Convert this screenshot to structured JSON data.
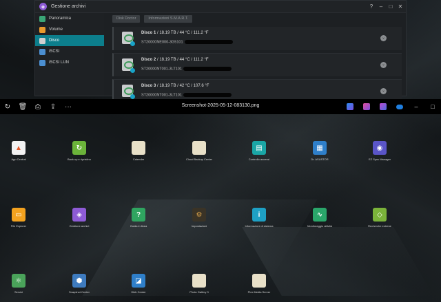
{
  "dsm_window": {
    "title": "Gestione archivi",
    "controls": [
      "?",
      "–",
      "□",
      "✕"
    ],
    "sidebar": [
      {
        "label": "Panoramica",
        "icon": "overview-icon",
        "color": "#3aa676"
      },
      {
        "label": "Volume",
        "icon": "volume-icon",
        "color": "#e89a2c"
      },
      {
        "label": "Disco",
        "icon": "disk-icon",
        "color": "#d0d0d0",
        "active": true
      },
      {
        "label": "iSCSI",
        "icon": "iscsi-icon",
        "color": "#4b8fd1"
      },
      {
        "label": "iSCSI LUN",
        "icon": "iscsi-lun-icon",
        "color": "#4b8fd1"
      }
    ],
    "tabs": [
      "Disk Doctor",
      "Informazioni S.M.A.R.T."
    ],
    "disks": [
      {
        "name": "Disco 1",
        "specs": " / 18.19 TB / 44 °C / 111.2 °F",
        "serial": "ST20000NE000-3G5101 "
      },
      {
        "name": "Disco 2",
        "specs": " / 18.19 TB / 44 °C / 111.2 °F",
        "serial": "ST20000NT001-3LT101 "
      },
      {
        "name": "Disco 3",
        "specs": " / 18.19 TB / 42 °C / 107.6 °F",
        "serial": "ST20000NT001-3LT101 "
      }
    ]
  },
  "viewer": {
    "filename": "Screenshot-2025-05-12-083130.png",
    "toolbar_left": [
      {
        "icon": "rotate-icon",
        "glyph": "↻"
      },
      {
        "icon": "delete-icon",
        "glyph": "🗑"
      },
      {
        "icon": "print-icon",
        "glyph": "⎙"
      },
      {
        "icon": "share-icon",
        "glyph": "⇪"
      },
      {
        "icon": "more-icon",
        "glyph": "···"
      }
    ],
    "window_controls": [
      "–",
      "□"
    ]
  },
  "apps": [
    {
      "label": "App Central",
      "color": "#f2f2f2",
      "glyph": "▲",
      "glyph_color": "#e45a2c"
    },
    {
      "label": "Back up e ripristino",
      "color": "#6bb33a",
      "glyph": "↻",
      "glyph_color": "#ffffff"
    },
    {
      "label": "Calendar",
      "color": "#e8e0c8",
      "glyph": "",
      "glyph_color": "#ffffff"
    },
    {
      "label": "Cloud Backup Center",
      "color": "#e8e0c8",
      "glyph": "",
      "glyph_color": "#ffffff"
    },
    {
      "label": "Controllo accessi",
      "color": "#1aa6a6",
      "glyph": "▤",
      "glyph_color": "#ffffff"
    },
    {
      "label": "Dr. ASUSTOR",
      "color": "#2f7fc9",
      "glyph": "▦",
      "glyph_color": "#ffffff"
    },
    {
      "label": "EZ Sync Manager",
      "color": "#5a55c8",
      "glyph": "◉",
      "glyph_color": "#ffffff"
    },
    {
      "label": "File Explorer",
      "color": "#f3a21f",
      "glyph": "▭",
      "glyph_color": "#ffffff"
    },
    {
      "label": "Gestione archivi",
      "color": "#8e5bd6",
      "glyph": "◈",
      "glyph_color": "#ffffff"
    },
    {
      "label": "Guida in linea",
      "color": "#2fa560",
      "glyph": "?",
      "glyph_color": "#ffffff"
    },
    {
      "label": "Impostazioni",
      "color": "#3a3326",
      "glyph": "⚙",
      "glyph_color": "#d9a24a"
    },
    {
      "label": "Informazioni di sistema",
      "color": "#1ea0c4",
      "glyph": "i",
      "glyph_color": "#ffffff"
    },
    {
      "label": "Monitoraggio attività",
      "color": "#2aa66a",
      "glyph": "∿",
      "glyph_color": "#ffffff"
    },
    {
      "label": "Recherche estrene",
      "color": "#7bb33a",
      "glyph": "◇",
      "glyph_color": "#ffffff"
    },
    {
      "label": "Servizi",
      "color": "#4aa35a",
      "glyph": "⚛",
      "glyph_color": "#ffffff"
    },
    {
      "label": "Snapshot Center",
      "color": "#3e7bbf",
      "glyph": "⬢",
      "glyph_color": "#ffffff"
    },
    {
      "label": "Web Center",
      "color": "#2f7fc9",
      "glyph": "◪",
      "glyph_color": "#ffffff"
    },
    {
      "label": "Photo Gallery 3",
      "color": "#e8e0c8",
      "glyph": "",
      "glyph_color": "#ffffff"
    },
    {
      "label": "Plex Media Server",
      "color": "#e8e0c8",
      "glyph": "",
      "glyph_color": "#ffffff"
    }
  ]
}
